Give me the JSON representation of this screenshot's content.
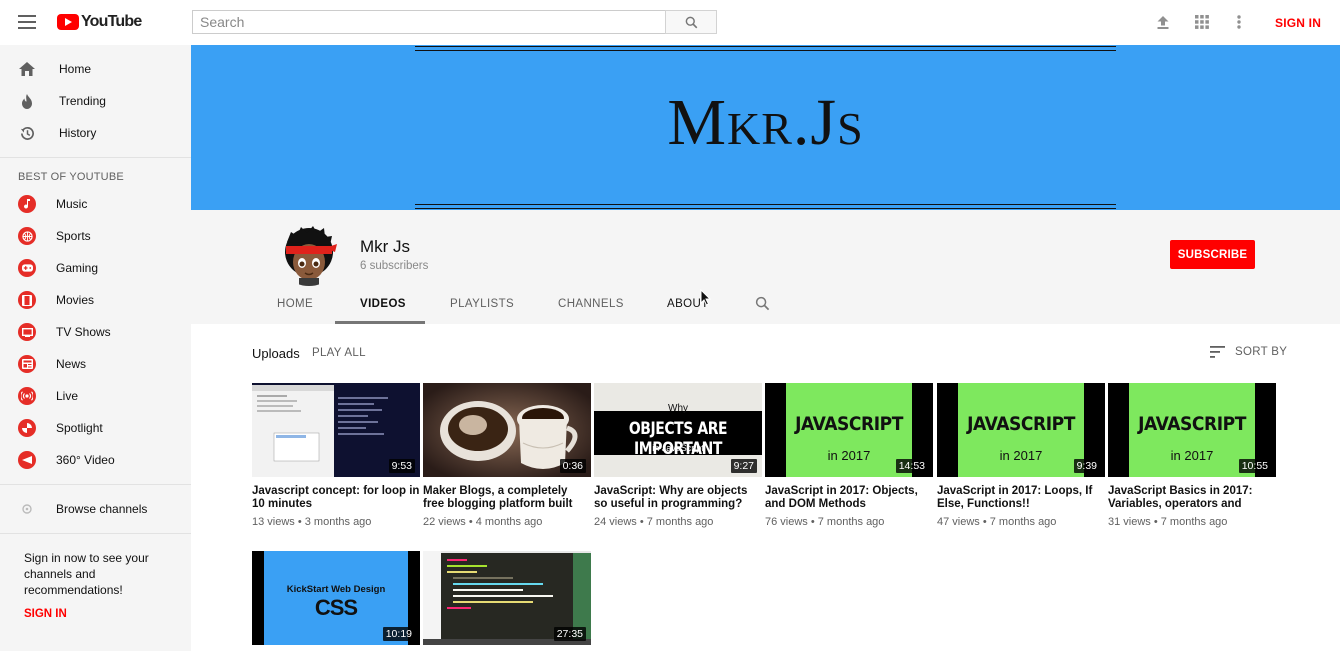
{
  "header": {
    "logo_text": "YouTube",
    "search_placeholder": "Search",
    "sign_in": "SIGN IN"
  },
  "sidebar": {
    "main": [
      {
        "label": "Home",
        "icon": "home-icon"
      },
      {
        "label": "Trending",
        "icon": "trending-icon"
      },
      {
        "label": "History",
        "icon": "history-icon"
      }
    ],
    "best_title": "BEST OF YOUTUBE",
    "best": [
      {
        "label": "Music",
        "icon": "music-icon"
      },
      {
        "label": "Sports",
        "icon": "sports-icon"
      },
      {
        "label": "Gaming",
        "icon": "gaming-icon"
      },
      {
        "label": "Movies",
        "icon": "movies-icon"
      },
      {
        "label": "TV Shows",
        "icon": "tv-icon"
      },
      {
        "label": "News",
        "icon": "news-icon"
      },
      {
        "label": "Live",
        "icon": "live-icon"
      },
      {
        "label": "Spotlight",
        "icon": "spotlight-icon"
      },
      {
        "label": "360° Video",
        "icon": "360-video-icon"
      }
    ],
    "browse": "Browse channels",
    "signin_prompt": "Sign in now to see your channels and recommendations!",
    "signin_link": "SIGN IN"
  },
  "channel": {
    "banner_title": "Mkr.Js",
    "name": "Mkr Js",
    "subscribers": "6 subscribers",
    "subscribe": "SUBSCRIBE",
    "tabs": [
      "HOME",
      "VIDEOS",
      "PLAYLISTS",
      "CHANNELS",
      "ABOUT"
    ],
    "active_tab": "VIDEOS"
  },
  "uploads": {
    "label": "Uploads",
    "play_all": "PLAY ALL",
    "sort_by": "SORT BY"
  },
  "videos": [
    {
      "title": "Javascript concept: for loop in 10 minutes",
      "meta": "13 views • 3 months ago",
      "duration": "9:53"
    },
    {
      "title": "Maker Blogs, a completely free blogging platform built",
      "meta": "22 views • 4 months ago",
      "duration": "0:36"
    },
    {
      "title": "JavaScript: Why are objects so useful in programming?",
      "meta": "24 views • 7 months ago",
      "duration": "9:27",
      "thumb_top": "Why",
      "thumb_main": "OBJECTS ARE IMPORTANT",
      "thumb_sub": "in JavaScript"
    },
    {
      "title": "JavaScript in 2017: Objects, and DOM Methods",
      "meta": "76 views • 7 months ago",
      "duration": "14:53",
      "thumb_main": "JAVASCRIPT",
      "thumb_sub": "in 2017"
    },
    {
      "title": "JavaScript in 2017: Loops, If Else, Functions!!",
      "meta": "47 views • 7 months ago",
      "duration": "9:39",
      "thumb_main": "JAVASCRIPT",
      "thumb_sub": "in 2017"
    },
    {
      "title": "JavaScript Basics in 2017: Variables, operators and",
      "meta": "31 views • 7 months ago",
      "duration": "10:55",
      "thumb_main": "JAVASCRIPT",
      "thumb_sub": "in 2017"
    },
    {
      "duration": "10:19",
      "thumb_top": "KickStart Web Design",
      "thumb_main": "CSS"
    },
    {
      "duration": "27:35"
    }
  ]
}
